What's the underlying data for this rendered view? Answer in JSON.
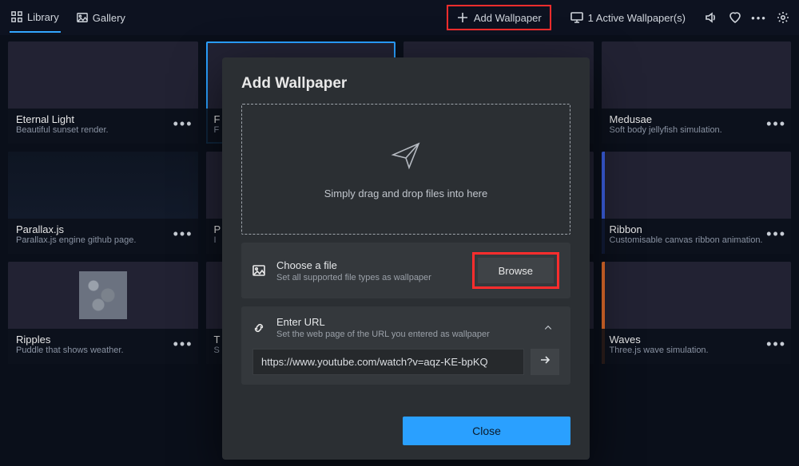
{
  "topbar": {
    "library_label": "Library",
    "gallery_label": "Gallery",
    "add_wallpaper_label": "Add Wallpaper",
    "active_wallpapers_label": "1 Active Wallpaper(s)"
  },
  "cards": [
    {
      "title": "Eternal Light",
      "sub": "Beautiful sunset render."
    },
    {
      "title": "F",
      "sub": "F"
    },
    {
      "title": "",
      "sub": ""
    },
    {
      "title": "Medusae",
      "sub": "Soft body jellyfish simulation."
    },
    {
      "title": "Parallax.js",
      "sub": "Parallax.js engine github page."
    },
    {
      "title": "P",
      "sub": "I"
    },
    {
      "title": "",
      "sub": ""
    },
    {
      "title": "Ribbon",
      "sub": "Customisable canvas ribbon animation."
    },
    {
      "title": "Ripples",
      "sub": "Puddle that shows weather."
    },
    {
      "title": "T",
      "sub": "S"
    },
    {
      "title": "",
      "sub": ""
    },
    {
      "title": "Waves",
      "sub": "Three.js wave simulation."
    }
  ],
  "dialog": {
    "title": "Add Wallpaper",
    "drop_hint": "Simply drag and drop files into here",
    "choose_file_title": "Choose a file",
    "choose_file_sub": "Set all supported file types as wallpaper",
    "browse_label": "Browse",
    "enter_url_title": "Enter URL",
    "enter_url_sub": "Set the web page of the URL you entered as wallpaper",
    "url_value": "https://www.youtube.com/watch?v=aqz-KE-bpKQ",
    "close_label": "Close"
  }
}
